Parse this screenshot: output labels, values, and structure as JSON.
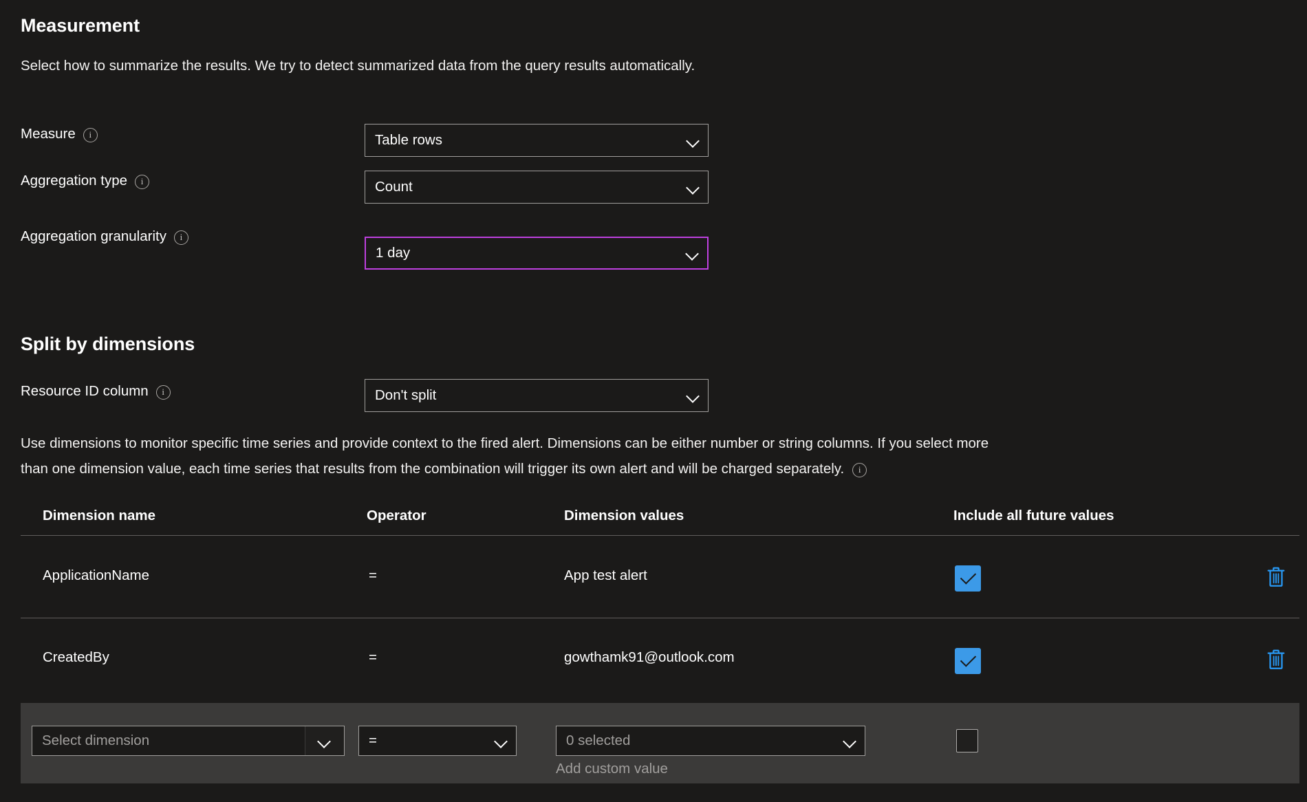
{
  "measurement": {
    "title": "Measurement",
    "description": "Select how to summarize the results. We try to detect summarized data from the query results automatically.",
    "fields": [
      {
        "label": "Measure",
        "value": "Table rows",
        "info": "info-icon",
        "focused": false
      },
      {
        "label": "Aggregation type",
        "value": "Count",
        "info": "info-icon",
        "focused": false
      },
      {
        "label": "Aggregation granularity",
        "value": "1 day",
        "info": "info-icon",
        "focused": true
      }
    ]
  },
  "split_by_dimensions": {
    "title": "Split by dimensions",
    "resource_id_column": {
      "label": "Resource ID column",
      "value": "Don't split"
    },
    "description_line1": "Use dimensions to monitor specific time series and provide context to the fired alert. Dimensions can be either number or string columns. If you select more",
    "description_line2": "than one dimension value, each time series that results from the combination will trigger its own alert and will be charged separately.",
    "table": {
      "headers": [
        "Dimension name",
        "Operator",
        "Dimension values",
        "Include all future values"
      ],
      "rows": [
        {
          "dimension_name": "ApplicationName",
          "operator": "=",
          "dimension_values": "App test alert",
          "include_all_future_values": true,
          "delete_icon": "trash-icon"
        },
        {
          "dimension_name": "CreatedBy",
          "operator": "=",
          "dimension_values": "gowthamk91@outlook.com",
          "include_all_future_values": true,
          "delete_icon": "trash-icon"
        }
      ],
      "new_row": {
        "dimension_placeholder": "Select dimension",
        "operator_value": "=",
        "values_placeholder": "0 selected",
        "add_custom_value_label": "Add custom value",
        "include_all_future_values": false
      }
    }
  },
  "colors": {
    "background": "#1b1a19",
    "panel": "#3b3a39",
    "accent_checkbox": "#3c9ae8",
    "accent_icon": "#2899f5",
    "focus_border": "#bf40e0",
    "border": "#a19f9d",
    "divider": "#605e5c",
    "muted_text": "#a19f9d"
  }
}
